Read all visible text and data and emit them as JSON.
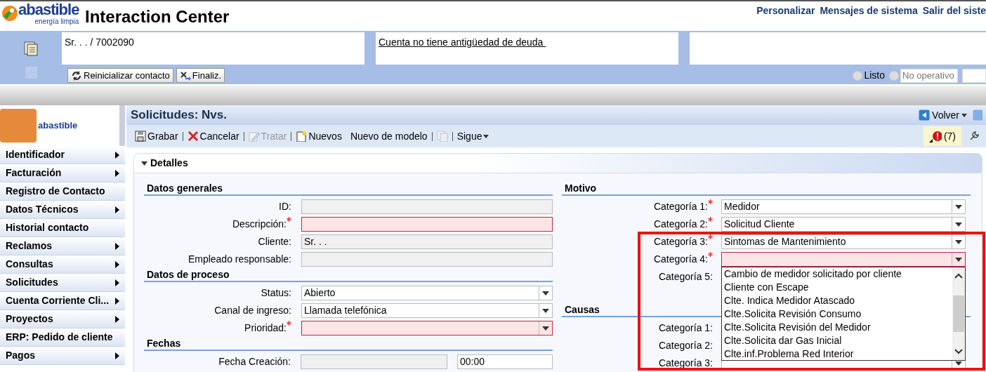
{
  "header": {
    "logo_text": "abastible",
    "logo_tagline": "energía limpia",
    "title": "Interaction Center",
    "links": [
      "Personalizar",
      "Mensajes de sistema",
      "Salir del siste"
    ]
  },
  "contact_bar": {
    "contact": "Sr. . . / 7002090",
    "alert": "Cuenta no tiene antigüedad de deuda ",
    "buttons": [
      {
        "label": "Reinicializar contacto",
        "kind": "reset"
      },
      {
        "label": "Finaliz.",
        "kind": "end"
      }
    ],
    "status": [
      {
        "kind": "label",
        "label": "Listo",
        "selected": false
      },
      {
        "kind": "field",
        "placeholder": "No operativo",
        "selected": false
      }
    ]
  },
  "sidebar": {
    "logo_text": "abastible",
    "items": [
      {
        "label": "Identificador",
        "has_submenu": true
      },
      {
        "label": "Facturación",
        "has_submenu": true
      },
      {
        "label": "Registro de Contacto",
        "has_submenu": false
      },
      {
        "label": "Datos Técnicos",
        "has_submenu": true
      },
      {
        "label": "Historial contacto",
        "has_submenu": false
      },
      {
        "label": "Reclamos",
        "has_submenu": true
      },
      {
        "label": "Consultas",
        "has_submenu": true
      },
      {
        "label": "Solicitudes",
        "has_submenu": true
      },
      {
        "label": "Cuenta Corriente Cli...",
        "has_submenu": true
      },
      {
        "label": "Proyectos",
        "has_submenu": true
      },
      {
        "label": "ERP: Pedido de cliente",
        "has_submenu": false
      },
      {
        "label": "Pagos",
        "has_submenu": true
      }
    ]
  },
  "page": {
    "title": "Solicitudes: Nvs.",
    "back": "Volver",
    "messages": "(7)",
    "toolbar": [
      {
        "kind": "save",
        "label": "Grabar",
        "disabled": false
      },
      {
        "kind": "cancel",
        "label": "Cancelar",
        "disabled": false
      },
      {
        "kind": "edit",
        "label": "Tratar",
        "disabled": true
      },
      {
        "kind": "new",
        "label": "Nuevos",
        "disabled": false
      },
      {
        "kind": "plain",
        "label": "Nuevo de modelo",
        "disabled": false
      },
      {
        "kind": "copy",
        "disabled": true
      },
      {
        "kind": "menu",
        "label": "Sigue",
        "disabled": false
      }
    ]
  },
  "panel": {
    "title": "Detalles",
    "expanded": true,
    "columns": [
      [
        {
          "title": "Datos generales",
          "fields": [
            {
              "label": "ID:",
              "required": false,
              "kind": "input",
              "readonly": true,
              "invalid": false
            },
            {
              "label": "Descripción:",
              "required": true,
              "kind": "input",
              "readonly": false,
              "invalid": true
            },
            {
              "label": "Cliente:",
              "required": false,
              "kind": "input",
              "readonly": true,
              "invalid": false,
              "value": "Sr. . ."
            },
            {
              "label": "Empleado responsable:",
              "required": false,
              "kind": "input",
              "readonly": true,
              "invalid": false
            }
          ]
        },
        {
          "title": "Datos de proceso",
          "fields": [
            {
              "label": "Status:",
              "required": false,
              "kind": "select",
              "readonly": false,
              "invalid": false,
              "value": "Abierto"
            },
            {
              "label": "Canal de ingreso:",
              "required": false,
              "kind": "select",
              "readonly": false,
              "invalid": false,
              "value": "Llamada telefónica"
            },
            {
              "label": "Prioridad:",
              "required": true,
              "kind": "select",
              "readonly": false,
              "invalid": true
            }
          ]
        },
        {
          "title": "Fechas",
          "fields": [
            {
              "label": "Fecha Creación:",
              "required": false,
              "kind": "datetime",
              "readonly": true,
              "invalid": false,
              "time": "00:00"
            }
          ]
        }
      ],
      [
        {
          "title": "Motivo",
          "fields": [
            {
              "label": "Categoría 1:",
              "required": true,
              "kind": "select",
              "readonly": false,
              "invalid": false,
              "value": "Medidor"
            },
            {
              "label": "Categoría 2:",
              "required": true,
              "kind": "select",
              "readonly": false,
              "invalid": false,
              "value": "Solicitud Cliente"
            },
            {
              "label": "Categoría 3:",
              "required": true,
              "kind": "select",
              "readonly": false,
              "invalid": false,
              "value": "Sintomas de Mantenimiento"
            },
            {
              "label": "Categoría 4:",
              "required": true,
              "kind": "select",
              "readonly": false,
              "invalid": true,
              "expanded": true,
              "options": [
                "Cambio de medidor solicitado por cliente",
                "Cliente con Escape",
                "Clte. Indica Medidor Atascado",
                "Clte.Solicita Revisión Consumo",
                "Clte.Solicita Revisión del Medidor",
                "Clte.Solicita dar Gas Inicial",
                "Clte.inf.Problema Red Interior"
              ]
            },
            {
              "label": "Categoría 5:",
              "required": false,
              "kind": "covered"
            }
          ]
        },
        {
          "title": "Causas",
          "fields": [
            {
              "label": "Categoría 1:",
              "required": false,
              "kind": "covered"
            },
            {
              "label": "Categoría 2:",
              "required": false,
              "kind": "covered"
            },
            {
              "label": "Categoría 3:",
              "required": false,
              "kind": "select",
              "readonly": false,
              "invalid": false
            }
          ]
        }
      ]
    ]
  },
  "annotations": [
    {
      "kind": "rectangle"
    }
  ]
}
